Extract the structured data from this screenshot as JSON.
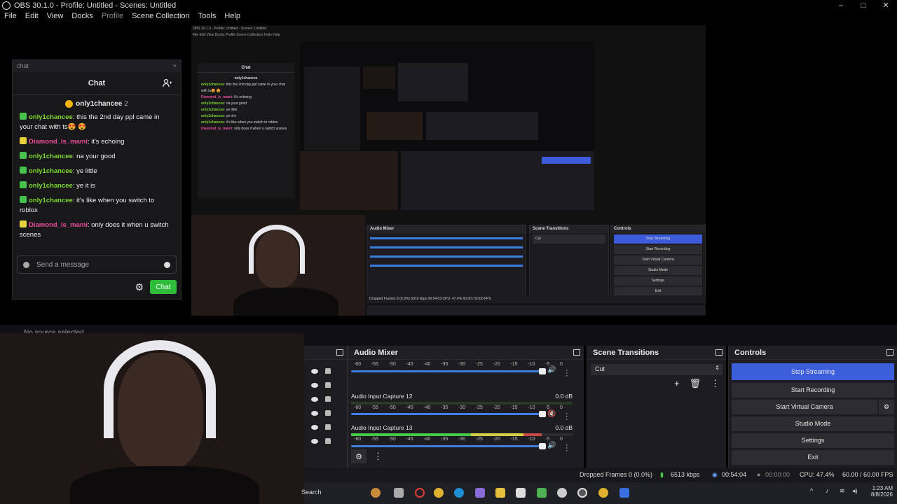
{
  "window": {
    "title": "OBS 30.1.0 - Profile: Untitled - Scenes: Untitled",
    "controls": [
      "–",
      "□",
      "✕"
    ]
  },
  "menu": [
    "File",
    "Edit",
    "View",
    "Docks",
    "Profile",
    "Scene Collection",
    "Tools",
    "Help"
  ],
  "chat": {
    "url_label": "chat",
    "header": "Chat",
    "pinned_user": "only1chancee",
    "pinned_count": "2",
    "messages": [
      {
        "user": "only1chancee",
        "badge": "green",
        "text": "this the 2nd day ppl came in your chat with ts😍 😍"
      },
      {
        "user": "Diamond_is_mami",
        "badge": "yellow",
        "text": "it's echoing"
      },
      {
        "user": "only1chancee",
        "badge": "green",
        "text": "na your good"
      },
      {
        "user": "only1chancee",
        "badge": "green",
        "text": "ye little"
      },
      {
        "user": "only1chancee",
        "badge": "green",
        "text": "ye it is"
      },
      {
        "user": "only1chancee",
        "badge": "green",
        "text": "it's like when you switch to roblox"
      },
      {
        "user": "Diamond_is_mami",
        "badge": "yellow",
        "text": "only does it when u switch scenes"
      }
    ],
    "input_placeholder": "Send a message",
    "send_label": "Chat"
  },
  "nested": {
    "title": "OBS 30.1.0 - Profile: Untitled - Scenes: Untitled",
    "menu": "File  Edit  View  Docks  Profile  Scene Collection  Tools  Help",
    "mixer": "Audio Mixer",
    "transitions": "Scene Transitions",
    "controls": "Controls",
    "buttons": [
      "Stop Streaming",
      "Start Recording",
      "Start Virtual Camera",
      "Studio Mode",
      "Settings",
      "Exit"
    ],
    "status": "Dropped Frames 8 (0.3%)   6019 kbps   00:54:03   CPU: 47.4%   60.00 / 60.00 FPS"
  },
  "docks": {
    "sources_label": "No source selected",
    "mixer_title": "Audio Mixer",
    "transitions_title": "Scene Transitions",
    "controls_title": "Controls"
  },
  "mixer": {
    "ticks": [
      "-60",
      "-55",
      "-50",
      "-45",
      "-40",
      "-35",
      "-30",
      "-25",
      "-20",
      "-15",
      "-10",
      "-5",
      "0"
    ],
    "channels": [
      {
        "name": "",
        "db": "",
        "level": 0
      },
      {
        "name": "Audio Input Capture 12",
        "db": "0.0 dB",
        "level": 0
      },
      {
        "name": "Audio Input Capture 13",
        "db": "0.0 dB",
        "level": 0.86
      }
    ]
  },
  "transitions": {
    "selected": "Cut"
  },
  "controls": {
    "stop_streaming": "Stop Streaming",
    "start_recording": "Start Recording",
    "start_virtual_camera": "Start Virtual Camera",
    "studio_mode": "Studio Mode",
    "settings": "Settings",
    "exit": "Exit"
  },
  "status": {
    "dropped_frames": "Dropped Frames 0 (0.0%)",
    "bitrate": "6513 kbps",
    "stream_time": "00:54:04",
    "rec_time": "00:00:00",
    "cpu": "CPU: 47.4%",
    "fps": "60.00 / 60.00 FPS"
  },
  "taskbar": {
    "search": "Search",
    "time": "1:23 AM",
    "date": "8/8/2026"
  },
  "colors": {
    "accent_blue": "#3d5edb",
    "chat_button": "#2ebd3a",
    "user_green": "#7bd82c",
    "user_pink": "#e84d9c"
  }
}
